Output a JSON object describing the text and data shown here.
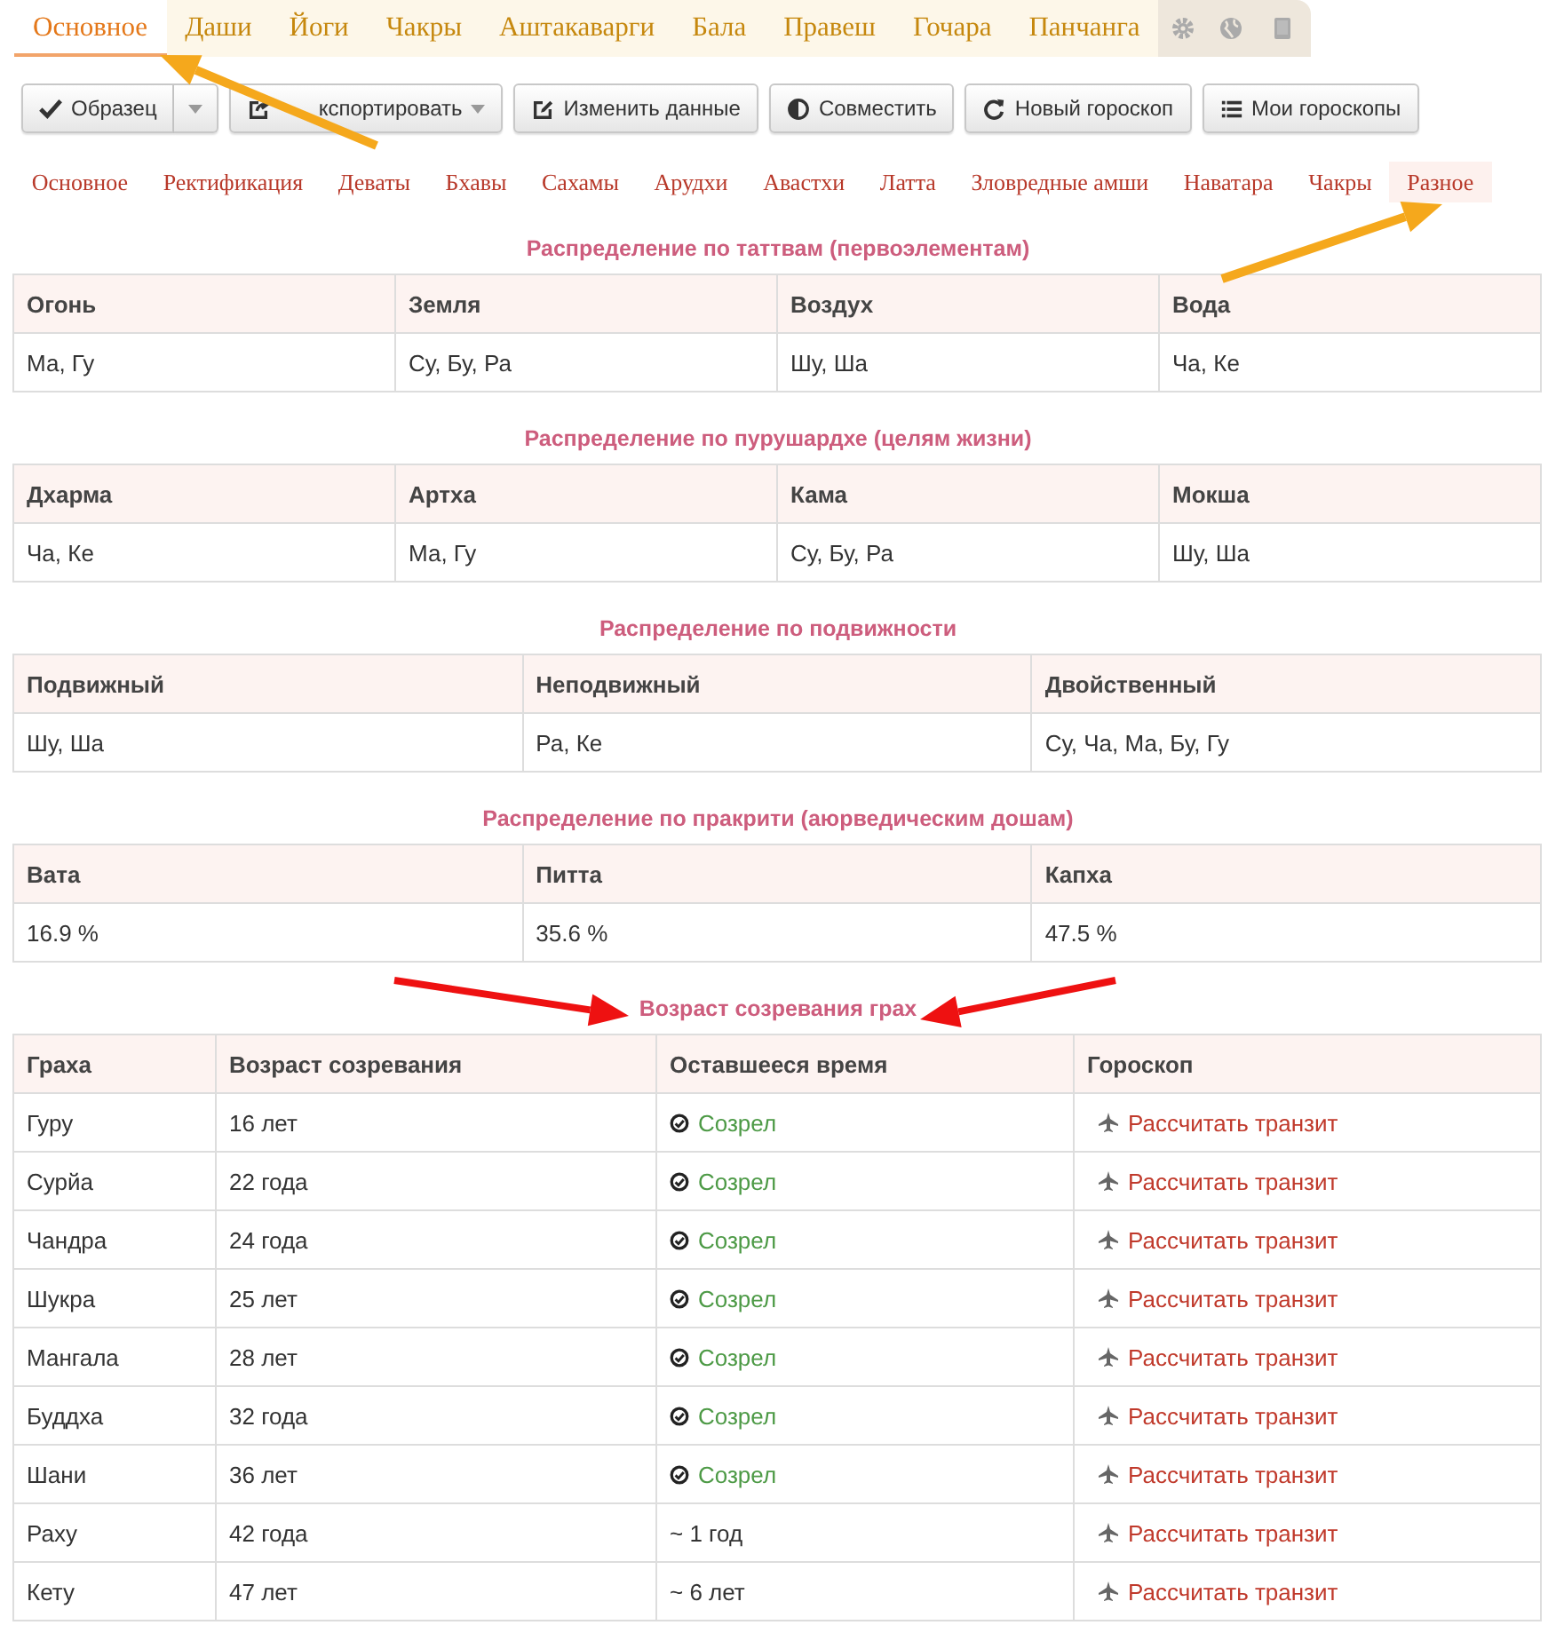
{
  "main_tabs": [
    {
      "label": "Основное",
      "selected": true
    },
    {
      "label": "Даши",
      "selected": false
    },
    {
      "label": "Йоги",
      "selected": false
    },
    {
      "label": "Чакры",
      "selected": false
    },
    {
      "label": "Аштакаварги",
      "selected": false
    },
    {
      "label": "Бала",
      "selected": false
    },
    {
      "label": "Правеш",
      "selected": false
    },
    {
      "label": "Гочара",
      "selected": false
    },
    {
      "label": "Панчанга",
      "selected": false
    }
  ],
  "icon_tabs": [
    {
      "kind": "gear",
      "selected": false
    },
    {
      "kind": "globe",
      "selected": false
    },
    {
      "kind": "book",
      "selected": false
    }
  ],
  "toolbar": [
    {
      "kind": "check",
      "label": "Образец",
      "split": true,
      "caret": false,
      "covered": false
    },
    {
      "kind": "export",
      "label": "кспортировать",
      "split": false,
      "caret": true,
      "covered": true
    },
    {
      "kind": "edit",
      "label": "Изменить данные",
      "split": false,
      "caret": false,
      "covered": false
    },
    {
      "kind": "contrast",
      "label": "Совместить",
      "split": false,
      "caret": false,
      "covered": false
    },
    {
      "kind": "refresh",
      "label": "Новый гороскоп",
      "split": false,
      "caret": false,
      "covered": false
    },
    {
      "kind": "list",
      "label": "Мои гороскопы",
      "split": false,
      "caret": false,
      "covered": false
    }
  ],
  "sub_tabs": [
    {
      "label": "Основное",
      "selected": false
    },
    {
      "label": "Ректификация",
      "selected": false
    },
    {
      "label": "Деваты",
      "selected": false
    },
    {
      "label": "Бхавы",
      "selected": false
    },
    {
      "label": "Сахамы",
      "selected": false
    },
    {
      "label": "Арудхи",
      "selected": false
    },
    {
      "label": "Авастхи",
      "selected": false
    },
    {
      "label": "Латта",
      "selected": false
    },
    {
      "label": "Зловредные амши",
      "selected": false
    },
    {
      "label": "Наватара",
      "selected": false
    },
    {
      "label": "Чакры",
      "selected": false
    },
    {
      "label": "Разное",
      "selected": true
    }
  ],
  "distributions": [
    {
      "title": "Распределение по таттвам (первоэлементам)",
      "columns": [
        "Огонь",
        "Земля",
        "Воздух",
        "Вода"
      ],
      "values": [
        "Ма, Гу",
        "Су, Бу, Ра",
        "Шу, Ша",
        "Ча, Ке"
      ]
    },
    {
      "title": "Распределение по пурушардхе (целям жизни)",
      "columns": [
        "Дхарма",
        "Артха",
        "Кама",
        "Мокша"
      ],
      "values": [
        "Ча, Ке",
        "Ма, Гу",
        "Су, Бу, Ра",
        "Шу, Ша"
      ]
    },
    {
      "title": "Распределение по подвижности",
      "columns": [
        "Подвижный",
        "Неподвижный",
        "Двойственный"
      ],
      "values": [
        "Шу, Ша",
        "Ра, Ке",
        "Су, Ча, Ма, Бу, Гу"
      ]
    },
    {
      "title": "Распределение по пракрити (аюрведическим дошам)",
      "columns": [
        "Вата",
        "Питта",
        "Капха"
      ],
      "values": [
        "16.9 %",
        "35.6 %",
        "47.5 %"
      ]
    }
  ],
  "maturity": {
    "title": "Возраст созревания грах",
    "columns": [
      "Граха",
      "Возраст созревания",
      "Оставшееся время",
      "Гороскоп"
    ],
    "rows": [
      {
        "graha": "Гуру",
        "age": "16 лет",
        "remaining": "Созрел",
        "matured": true,
        "link": "Рассчитать транзит"
      },
      {
        "graha": "Сурйа",
        "age": "22 года",
        "remaining": "Созрел",
        "matured": true,
        "link": "Рассчитать транзит"
      },
      {
        "graha": "Чандра",
        "age": "24 года",
        "remaining": "Созрел",
        "matured": true,
        "link": "Рассчитать транзит"
      },
      {
        "graha": "Шукра",
        "age": "25 лет",
        "remaining": "Созрел",
        "matured": true,
        "link": "Рассчитать транзит"
      },
      {
        "graha": "Мангала",
        "age": "28 лет",
        "remaining": "Созрел",
        "matured": true,
        "link": "Рассчитать транзит"
      },
      {
        "graha": "Буддха",
        "age": "32 года",
        "remaining": "Созрел",
        "matured": true,
        "link": "Рассчитать транзит"
      },
      {
        "graha": "Шани",
        "age": "36 лет",
        "remaining": "Созрел",
        "matured": true,
        "link": "Рассчитать транзит"
      },
      {
        "graha": "Раху",
        "age": "42 года",
        "remaining": "~ 1 год",
        "matured": false,
        "link": "Рассчитать транзит"
      },
      {
        "graha": "Кету",
        "age": "47 лет",
        "remaining": "~ 6 лет",
        "matured": false,
        "link": "Рассчитать транзит"
      }
    ]
  }
}
